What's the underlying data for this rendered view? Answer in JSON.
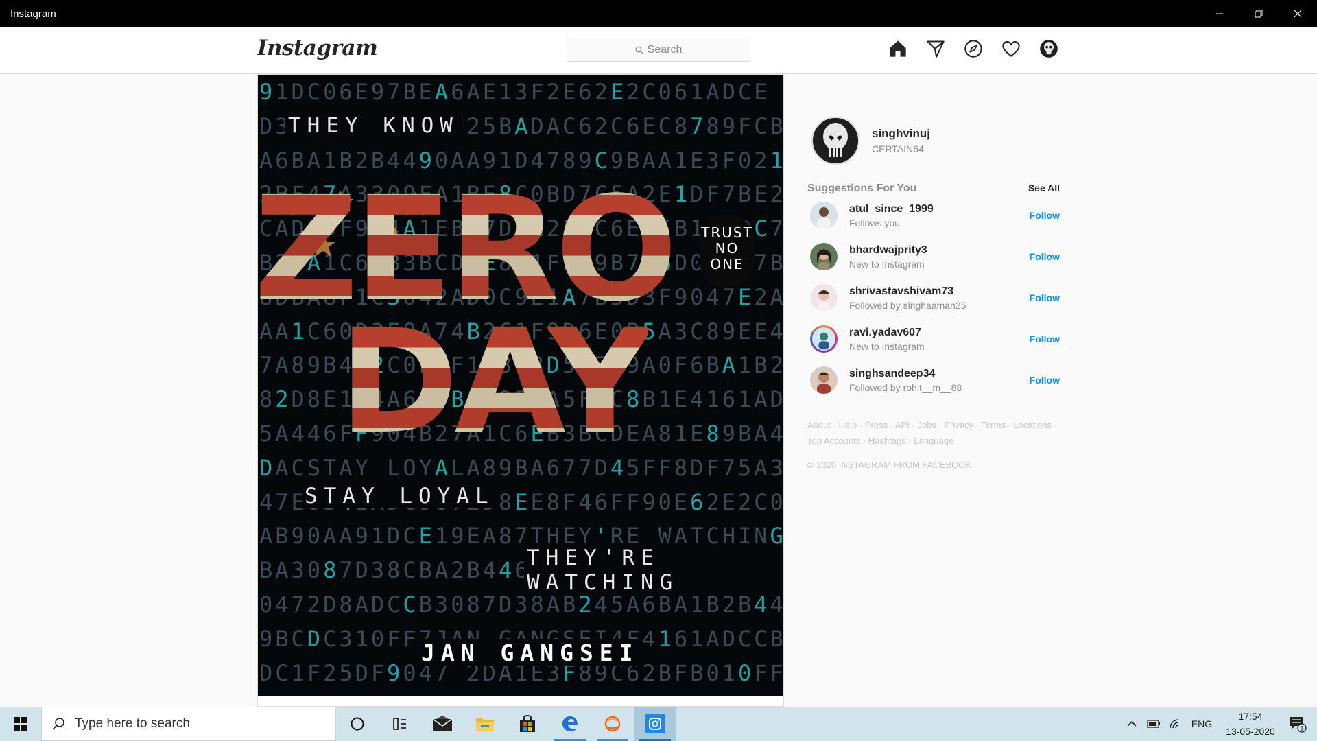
{
  "window": {
    "title": "Instagram",
    "controls": [
      "minimize-icon",
      "restore-icon",
      "close-icon"
    ]
  },
  "header": {
    "logo": "Instagram",
    "search_placeholder": "Search",
    "nav_icons": [
      "home-icon",
      "direct-icon",
      "explore-icon",
      "activity-icon",
      "profile-icon"
    ]
  },
  "post": {
    "taglines": {
      "top": "THEY KNOW",
      "middle": "STAY LOYAL",
      "lower": "THEY'RE WATCHING"
    },
    "title_line1": "ZERO",
    "title_line2": "DAY",
    "badge": [
      "TRUST",
      "NO",
      "ONE"
    ],
    "author": "JAN GANGSEI",
    "hex_rows": [
      "91DC06E97BEA6AE13F2E62E2C061ADCE",
      "D3THEY KNOW7F25BADAC62C6EC8789FCB",
      "A6BA1B2B4490AA91D4789C9BAA1E3F021",
      "2BF47A3309FA1BE8C0BD7C5A2E1DF7BE2",
      "CAD9DF9C4A1EB37D8A2F0C6E95B1A4DC7",
      "B27A1C6EB3BCD4E8A1F2C9B7A6D0E5F7B",
      "8DBA8F1C3042AD0C9E1A7B5D3F9047E2A",
      "AA1C60D3E8A74B2C1F9D6E0B5A3C89EE4",
      "7A89B4D2C0E6F1A3B8D5C7E9A0F6BA1B28",
      "82D8E1F4A6C0B3D9E7A5F2C8B1E4161ADD",
      "5A446FF904B27A1C6EB3BCDEA81E89BA4",
      "DACSTAY LOYALA89BA677D45FF8DF75A3",
      "47E0342ADC9672D8EE8F46FF90E62E2C0",
      "AB90AA91DCE19EA87THEY'RE WATCHING",
      "BA3087D38CBA2B446FF0342AD9C9BAA1",
      "0472D8ADCCB3087D38AB245A6BA1B2B44",
      "9BCDC310FF7JAN GANGSEI4F4161ADCCB",
      "DC1F25DF9047 2DA1E3F89C62BFB010FF7"
    ]
  },
  "sidebar": {
    "me": {
      "username": "singhvinuj",
      "fullname": "CERTAIN64"
    },
    "suggestions_title": "Suggestions For You",
    "see_all": "See All",
    "suggestions": [
      {
        "username": "atul_since_1999",
        "subtitle": "Follows you",
        "action": "Follow"
      },
      {
        "username": "bhardwajprity3",
        "subtitle": "New to Instagram",
        "action": "Follow"
      },
      {
        "username": "shrivastavshivam73",
        "subtitle": "Followed by singhaaman25",
        "action": "Follow"
      },
      {
        "username": "ravi.yadav607",
        "subtitle": "New to Instagram",
        "action": "Follow"
      },
      {
        "username": "singhsandeep34",
        "subtitle": "Followed by rohit__m__88",
        "action": "Follow"
      }
    ],
    "footer_links_line1": [
      "About",
      "Help",
      "Press",
      "API",
      "Jobs",
      "Privacy",
      "Terms",
      "Locations"
    ],
    "footer_links_line2": [
      "Top Accounts",
      "Hashtags",
      "Language"
    ],
    "copyright": "© 2020 INSTAGRAM FROM FACEBOOK"
  },
  "taskbar": {
    "search_placeholder": "Type here to search",
    "apps": [
      "cortana-icon",
      "task-view-icon",
      "mail-icon",
      "file-explorer-icon",
      "store-icon",
      "edge-icon",
      "app-icon",
      "instagram-icon"
    ],
    "tray": {
      "language": "ENG",
      "time": "17:54",
      "date": "13-05-2020",
      "notification_count": "1"
    }
  },
  "colors": {
    "accent_blue": "#0095f6",
    "taskbar_bg": "#d1e4ec",
    "titlebar_bg": "#000000"
  }
}
